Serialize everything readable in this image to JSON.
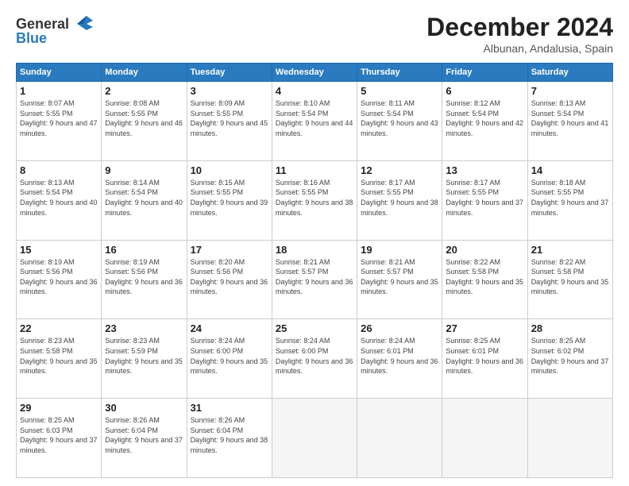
{
  "header": {
    "logo_general": "General",
    "logo_blue": "Blue",
    "title": "December 2024",
    "subtitle": "Albunan, Andalusia, Spain"
  },
  "columns": [
    "Sunday",
    "Monday",
    "Tuesday",
    "Wednesday",
    "Thursday",
    "Friday",
    "Saturday"
  ],
  "weeks": [
    [
      {
        "day": "1",
        "info": "Sunrise: 8:07 AM\nSunset: 5:55 PM\nDaylight: 9 hours and 47 minutes."
      },
      {
        "day": "2",
        "info": "Sunrise: 8:08 AM\nSunset: 5:55 PM\nDaylight: 9 hours and 46 minutes."
      },
      {
        "day": "3",
        "info": "Sunrise: 8:09 AM\nSunset: 5:55 PM\nDaylight: 9 hours and 45 minutes."
      },
      {
        "day": "4",
        "info": "Sunrise: 8:10 AM\nSunset: 5:54 PM\nDaylight: 9 hours and 44 minutes."
      },
      {
        "day": "5",
        "info": "Sunrise: 8:11 AM\nSunset: 5:54 PM\nDaylight: 9 hours and 43 minutes."
      },
      {
        "day": "6",
        "info": "Sunrise: 8:12 AM\nSunset: 5:54 PM\nDaylight: 9 hours and 42 minutes."
      },
      {
        "day": "7",
        "info": "Sunrise: 8:13 AM\nSunset: 5:54 PM\nDaylight: 9 hours and 41 minutes."
      }
    ],
    [
      {
        "day": "8",
        "info": "Sunrise: 8:13 AM\nSunset: 5:54 PM\nDaylight: 9 hours and 40 minutes."
      },
      {
        "day": "9",
        "info": "Sunrise: 8:14 AM\nSunset: 5:54 PM\nDaylight: 9 hours and 40 minutes."
      },
      {
        "day": "10",
        "info": "Sunrise: 8:15 AM\nSunset: 5:55 PM\nDaylight: 9 hours and 39 minutes."
      },
      {
        "day": "11",
        "info": "Sunrise: 8:16 AM\nSunset: 5:55 PM\nDaylight: 9 hours and 38 minutes."
      },
      {
        "day": "12",
        "info": "Sunrise: 8:17 AM\nSunset: 5:55 PM\nDaylight: 9 hours and 38 minutes."
      },
      {
        "day": "13",
        "info": "Sunrise: 8:17 AM\nSunset: 5:55 PM\nDaylight: 9 hours and 37 minutes."
      },
      {
        "day": "14",
        "info": "Sunrise: 8:18 AM\nSunset: 5:55 PM\nDaylight: 9 hours and 37 minutes."
      }
    ],
    [
      {
        "day": "15",
        "info": "Sunrise: 8:19 AM\nSunset: 5:56 PM\nDaylight: 9 hours and 36 minutes."
      },
      {
        "day": "16",
        "info": "Sunrise: 8:19 AM\nSunset: 5:56 PM\nDaylight: 9 hours and 36 minutes."
      },
      {
        "day": "17",
        "info": "Sunrise: 8:20 AM\nSunset: 5:56 PM\nDaylight: 9 hours and 36 minutes."
      },
      {
        "day": "18",
        "info": "Sunrise: 8:21 AM\nSunset: 5:57 PM\nDaylight: 9 hours and 36 minutes."
      },
      {
        "day": "19",
        "info": "Sunrise: 8:21 AM\nSunset: 5:57 PM\nDaylight: 9 hours and 35 minutes."
      },
      {
        "day": "20",
        "info": "Sunrise: 8:22 AM\nSunset: 5:58 PM\nDaylight: 9 hours and 35 minutes."
      },
      {
        "day": "21",
        "info": "Sunrise: 8:22 AM\nSunset: 5:58 PM\nDaylight: 9 hours and 35 minutes."
      }
    ],
    [
      {
        "day": "22",
        "info": "Sunrise: 8:23 AM\nSunset: 5:58 PM\nDaylight: 9 hours and 35 minutes."
      },
      {
        "day": "23",
        "info": "Sunrise: 8:23 AM\nSunset: 5:59 PM\nDaylight: 9 hours and 35 minutes."
      },
      {
        "day": "24",
        "info": "Sunrise: 8:24 AM\nSunset: 6:00 PM\nDaylight: 9 hours and 35 minutes."
      },
      {
        "day": "25",
        "info": "Sunrise: 8:24 AM\nSunset: 6:00 PM\nDaylight: 9 hours and 36 minutes."
      },
      {
        "day": "26",
        "info": "Sunrise: 8:24 AM\nSunset: 6:01 PM\nDaylight: 9 hours and 36 minutes."
      },
      {
        "day": "27",
        "info": "Sunrise: 8:25 AM\nSunset: 6:01 PM\nDaylight: 9 hours and 36 minutes."
      },
      {
        "day": "28",
        "info": "Sunrise: 8:25 AM\nSunset: 6:02 PM\nDaylight: 9 hours and 37 minutes."
      }
    ],
    [
      {
        "day": "29",
        "info": "Sunrise: 8:25 AM\nSunset: 6:03 PM\nDaylight: 9 hours and 37 minutes."
      },
      {
        "day": "30",
        "info": "Sunrise: 8:26 AM\nSunset: 6:04 PM\nDaylight: 9 hours and 37 minutes."
      },
      {
        "day": "31",
        "info": "Sunrise: 8:26 AM\nSunset: 6:04 PM\nDaylight: 9 hours and 38 minutes."
      },
      {
        "day": "",
        "info": ""
      },
      {
        "day": "",
        "info": ""
      },
      {
        "day": "",
        "info": ""
      },
      {
        "day": "",
        "info": ""
      }
    ]
  ]
}
